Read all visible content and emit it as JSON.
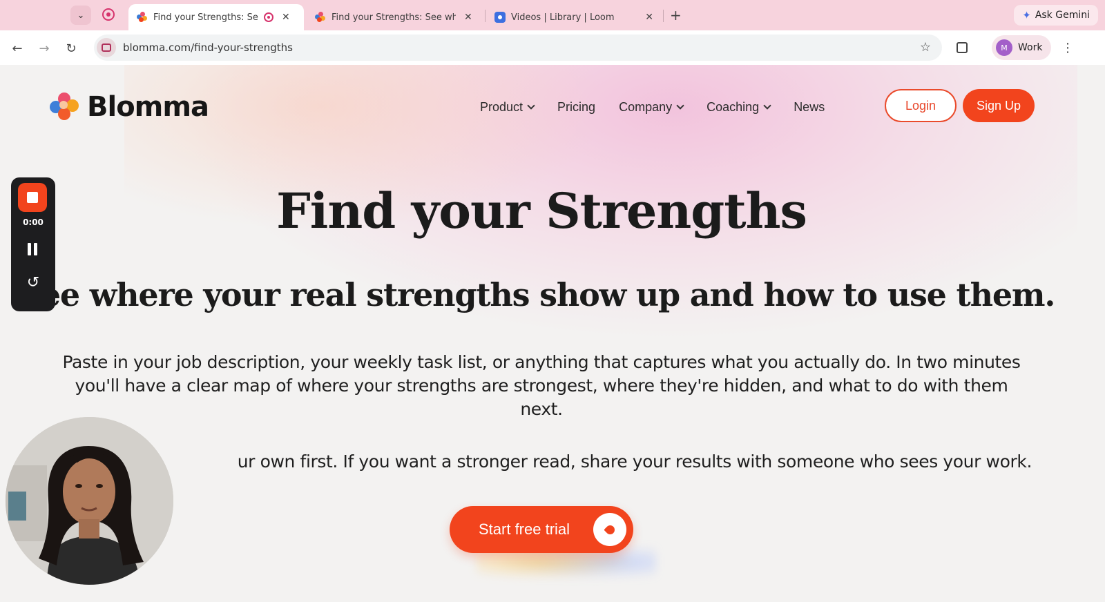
{
  "browser": {
    "tabs": [
      {
        "title": "Find your Strengths: See",
        "active": true
      },
      {
        "title": "Find your Strengths: See whe",
        "active": false
      },
      {
        "title": "Videos | Library | Loom",
        "active": false
      }
    ],
    "ask_gemini": "Ask Gemini",
    "url": "blomma.com/find-your-strengths",
    "profile": {
      "initial": "M",
      "label": "Work"
    }
  },
  "site": {
    "brand": "Blomma",
    "nav": [
      {
        "label": "Product",
        "has_dropdown": true
      },
      {
        "label": "Pricing",
        "has_dropdown": false
      },
      {
        "label": "Company",
        "has_dropdown": true
      },
      {
        "label": "Coaching",
        "has_dropdown": true
      },
      {
        "label": "News",
        "has_dropdown": false
      }
    ],
    "login_label": "Login",
    "signup_label": "Sign Up"
  },
  "hero": {
    "title": "Find your Strengths",
    "subtitle": "See where your real strengths show up and how to use them.",
    "description": "Paste in your job description, your weekly task list, or anything that captures what you actually do. In two minutes you'll have a clear map of where your strengths are strongest, where they're hidden, and what to do with them next.",
    "note": "ur own first. If you want a stronger read, share your results with someone who sees your work.",
    "cta_label": "Start free trial"
  },
  "recorder": {
    "time": "0:00"
  },
  "colors": {
    "accent": "#f2441d",
    "tab_strip": "#f7d3dd",
    "page_bg": "#f3f2f1"
  }
}
